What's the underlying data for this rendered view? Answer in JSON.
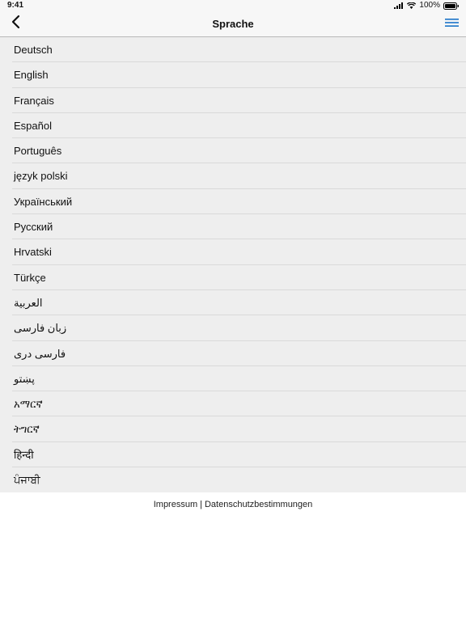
{
  "status_bar": {
    "time": "9:41",
    "battery": "100%"
  },
  "nav": {
    "title": "Sprache",
    "accent_color": "#1a73c8"
  },
  "languages": [
    "Deutsch",
    "English",
    "Français",
    "Español",
    "Português",
    "język polski",
    "Український",
    "Русский",
    "Hrvatski",
    "Türkçe",
    "العربية",
    "زبان فارسی",
    "فارسی دری",
    "پښتو",
    "አማርኛ",
    "ትግርኛ",
    "हिन्दी",
    "ਪੰਜਾਬੀ"
  ],
  "footer": {
    "imprint": "Impressum",
    "separator": "|",
    "privacy": "Datenschutzbestimmungen"
  }
}
